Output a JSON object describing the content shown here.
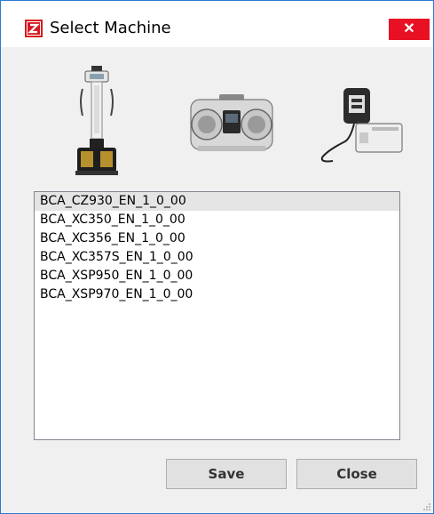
{
  "window": {
    "title": "Select Machine",
    "close_glyph": "✕"
  },
  "machines": [
    {
      "icon": "body-composition-analyzer-column-icon"
    },
    {
      "icon": "portable-analyzer-case-icon"
    },
    {
      "icon": "compact-analyzer-device-icon"
    }
  ],
  "models": [
    "BCA_CZ930_EN_1_0_00",
    "BCA_XC350_EN_1_0_00",
    "BCA_XC356_EN_1_0_00",
    "BCA_XC357S_EN_1_0_00",
    "BCA_XSP950_EN_1_0_00",
    "BCA_XSP970_EN_1_0_00"
  ],
  "selected_index": 0,
  "buttons": {
    "save_label": "Save",
    "close_label": "Close"
  },
  "colors": {
    "accent_border": "#2b7bd6",
    "close_red": "#e81123",
    "selection": "#e5e5e5"
  }
}
